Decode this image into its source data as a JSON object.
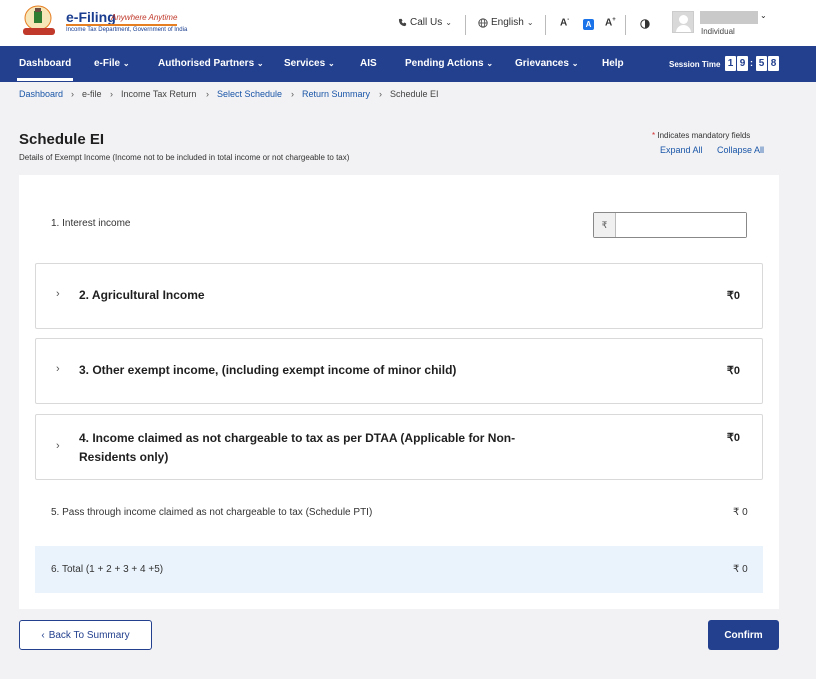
{
  "header": {
    "logo_title": "e-Filing",
    "logo_tagline": "Anywhere Anytime",
    "logo_sub": "Income Tax Department, Government of India",
    "call_us": "Call Us",
    "language": "English",
    "font_decrease": "A",
    "font_normal": "A",
    "font_increase": "A",
    "user_role": "Individual"
  },
  "nav": {
    "items": [
      "Dashboard",
      "e-File",
      "Authorised Partners",
      "Services",
      "AIS",
      "Pending Actions",
      "Grievances",
      "Help"
    ],
    "session_label": "Session Time",
    "session_digits": [
      "1",
      "9",
      "5",
      "8"
    ],
    "session_sep": ":"
  },
  "breadcrumb": [
    "Dashboard",
    "e-file",
    "Income Tax Return",
    "Select Schedule",
    "Return Summary",
    "Schedule EI"
  ],
  "page": {
    "title": "Schedule EI",
    "subtitle": "Details of Exempt Income (Income not to be included in total income or not chargeable to tax)",
    "mandatory_star": "*",
    "mandatory_text": "Indicates mandatory fields",
    "expand_all": "Expand All",
    "collapse_all": "Collapse All"
  },
  "schedule": {
    "interest_label": "1. Interest income",
    "interest_prefix": "₹",
    "interest_value": "",
    "agri_title": "2. Agricultural Income",
    "agri_value": "₹0",
    "other_title": "3. Other exempt income, (including exempt income of minor child)",
    "other_value": "₹0",
    "dtaa_title": "4. Income claimed as not chargeable to tax as per DTAA (Applicable for Non-Residents only)",
    "dtaa_value": "₹0",
    "pti_label": "5. Pass through income claimed as not chargeable to tax (Schedule PTI)",
    "pti_value": "₹ 0",
    "total_label": "6. Total (1 + 2 + 3 + 4 +5)",
    "total_value": "₹ 0"
  },
  "buttons": {
    "back": "Back To Summary",
    "confirm": "Confirm"
  }
}
